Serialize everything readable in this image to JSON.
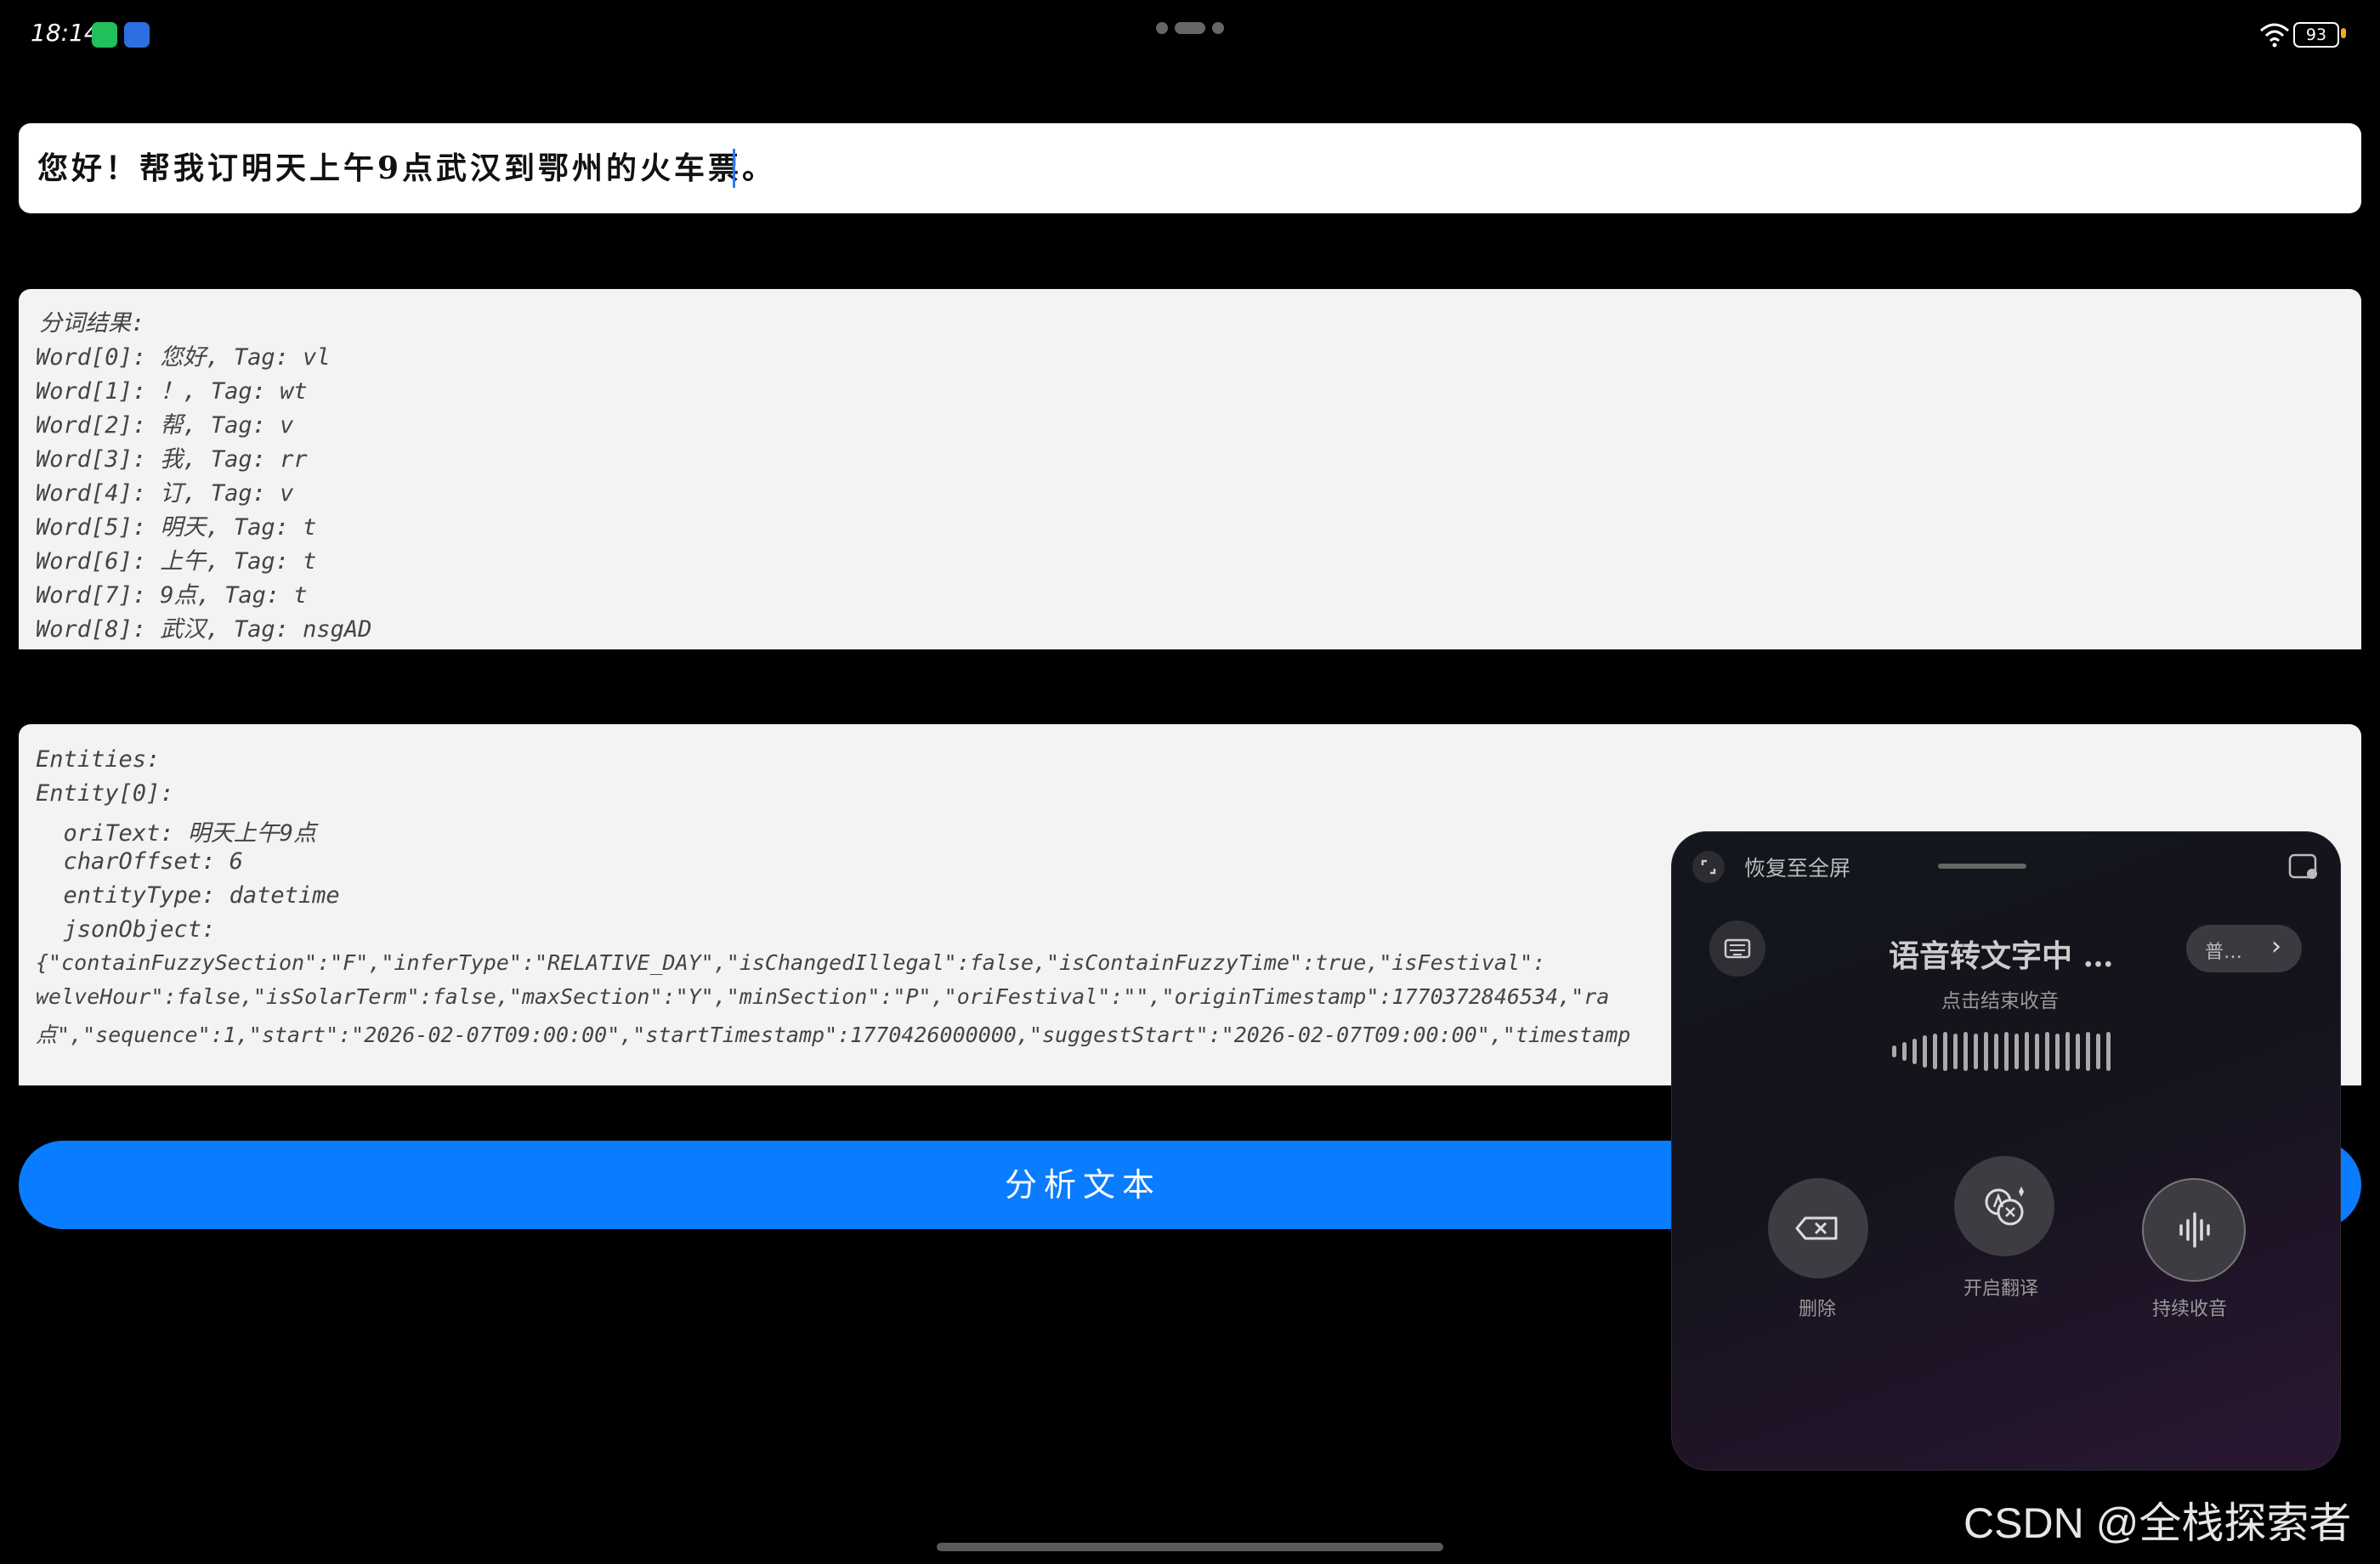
{
  "status_bar": {
    "time": "18:14",
    "battery": "93",
    "icons": [
      "wechat-icon",
      "app-icon",
      "wifi-icon",
      "battery-icon"
    ]
  },
  "input": {
    "value": "您好！帮我订明天上午9点武汉到鄂州的火车票。"
  },
  "segmentation": {
    "lines": [
      "分词结果:",
      "Word[0]: 您好, Tag: vl",
      "Word[1]: ！, Tag: wt",
      "Word[2]: 帮, Tag: v",
      "Word[3]: 我, Tag: rr",
      "Word[4]: 订, Tag: v",
      "Word[5]: 明天, Tag: t",
      "Word[6]: 上午, Tag: t",
      "Word[7]: 9点, Tag: t",
      "Word[8]: 武汉, Tag: nsgAD"
    ]
  },
  "entities": {
    "lines": [
      "Entities:",
      "Entity[0]:",
      "  oriText: 明天上午9点",
      "  charOffset: 6",
      "  entityType: datetime",
      "  jsonObject:",
      "{\"containFuzzySection\":\"F\",\"inferType\":\"RELATIVE_DAY\",\"isChangedIllegal\":false,\"isContainFuzzyTime\":true,\"isFestival\":",
      "welveHour\":false,\"isSolarTerm\":false,\"maxSection\":\"Y\",\"minSection\":\"P\",\"oriFestival\":\"\",\"originTimestamp\":1770372846534,\"ra",
      "点\",\"sequence\":1,\"start\":\"2026-02-07T09:00:00\",\"startTimestamp\":1770426000000,\"suggestStart\":\"2026-02-07T09:00:00\",\"timestamp"
    ]
  },
  "analyze_button": {
    "label": "分析文本"
  },
  "voice_panel": {
    "restore_label": "恢复至全屏",
    "title": "语音转文字中 …",
    "subtitle": "点击结束收音",
    "language": "普…",
    "delete_label": "删除",
    "translate_label": "开启翻译",
    "continue_label": "持续收音"
  },
  "watermark": "CSDN @全栈探索者",
  "colors": {
    "accent": "#0a7cff",
    "background": "#000000",
    "panel": "#f3f3f3"
  }
}
